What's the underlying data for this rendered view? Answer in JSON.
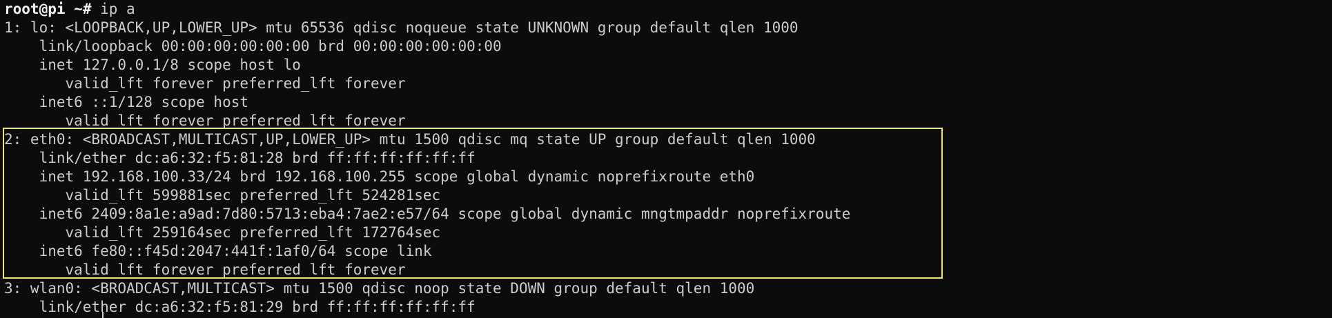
{
  "prompt": {
    "user_host": "root@pi",
    "path": " ~",
    "symbol": "# ",
    "command": "ip a"
  },
  "lines": [
    "1: lo: <LOOPBACK,UP,LOWER_UP> mtu 65536 qdisc noqueue state UNKNOWN group default qlen 1000",
    "    link/loopback 00:00:00:00:00:00 brd 00:00:00:00:00:00",
    "    inet 127.0.0.1/8 scope host lo",
    "       valid_lft forever preferred_lft forever",
    "    inet6 ::1/128 scope host",
    "       valid_lft forever preferred_lft forever",
    "2: eth0: <BROADCAST,MULTICAST,UP,LOWER_UP> mtu 1500 qdisc mq state UP group default qlen 1000",
    "    link/ether dc:a6:32:f5:81:28 brd ff:ff:ff:ff:ff:ff",
    "    inet 192.168.100.33/24 brd 192.168.100.255 scope global dynamic noprefixroute eth0",
    "       valid_lft 599881sec preferred_lft 524281sec",
    "    inet6 2409:8a1e:a9ad:7d80:5713:eba4:7ae2:e57/64 scope global dynamic mngtmpaddr noprefixroute",
    "       valid_lft 259164sec preferred_lft 172764sec",
    "    inet6 fe80::f45d:2047:441f:1af0/64 scope link",
    "       valid_lft forever preferred_lft forever",
    "3: wlan0: <BROADCAST,MULTICAST> mtu 1500 qdisc noop state DOWN group default qlen 1000",
    "    link/ether dc:a6:32:f5:81:29 brd ff:ff:ff:ff:ff:ff"
  ],
  "colors": {
    "background": "#0c0c0c",
    "foreground": "#cccccc",
    "highlight_border": "#f2e56b"
  }
}
